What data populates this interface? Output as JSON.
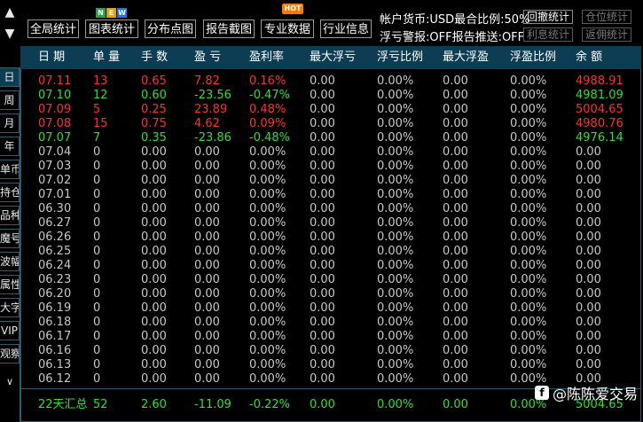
{
  "toolbar": {
    "buttons": [
      "全局统计",
      "图表统计",
      "分布点图",
      "报告截图",
      "专业数据",
      "行业信息"
    ],
    "new_badge": [
      "N",
      "E",
      "W"
    ],
    "hot_badge": "HOT"
  },
  "account": {
    "line1": "帐户货币:USD最合比例:50%",
    "line2": "浮亏警报:OFF报告推送:OFF",
    "buttons": [
      "回撤统计",
      "仓位统计",
      "利息统计",
      "返佣统计"
    ]
  },
  "scroll": {
    "up": "▲",
    "down": "▼",
    "sidebar_down": "∨"
  },
  "sidebar": {
    "items": [
      "日",
      "周",
      "月",
      "年",
      "单币",
      "持仓",
      "品种",
      "魔号",
      "波幅",
      "属性",
      "大字",
      "VIP",
      "观察"
    ],
    "active_index": 0
  },
  "table": {
    "columns": [
      "日 期",
      "单 量",
      "手 数",
      "盈 亏",
      "盈利率",
      "最大浮亏",
      "浮亏比例",
      "最大浮盈",
      "浮盈比例",
      "余 额"
    ],
    "rows": [
      {
        "date": "07.11",
        "orders": "13",
        "lots": "0.65",
        "pnl": "7.82",
        "rate": "0.16%",
        "max_float_loss": "0.00",
        "float_loss_ratio": "0.00%",
        "max_float_profit": "0.00",
        "float_profit_ratio": "0.00%",
        "balance": "4988.91",
        "tone": "red"
      },
      {
        "date": "07.10",
        "orders": "12",
        "lots": "0.60",
        "pnl": "-23.56",
        "rate": "-0.47%",
        "max_float_loss": "0.00",
        "float_loss_ratio": "0.00%",
        "max_float_profit": "0.00",
        "float_profit_ratio": "0.00%",
        "balance": "4981.09",
        "tone": "green"
      },
      {
        "date": "07.09",
        "orders": "5",
        "lots": "0.25",
        "pnl": "23.89",
        "rate": "0.48%",
        "max_float_loss": "0.00",
        "float_loss_ratio": "0.00%",
        "max_float_profit": "0.00",
        "float_profit_ratio": "0.00%",
        "balance": "5004.65",
        "tone": "red"
      },
      {
        "date": "07.08",
        "orders": "15",
        "lots": "0.75",
        "pnl": "4.62",
        "rate": "0.09%",
        "max_float_loss": "0.00",
        "float_loss_ratio": "0.00%",
        "max_float_profit": "0.00",
        "float_profit_ratio": "0.00%",
        "balance": "4980.76",
        "tone": "red"
      },
      {
        "date": "07.07",
        "orders": "7",
        "lots": "0.35",
        "pnl": "-23.86",
        "rate": "-0.48%",
        "max_float_loss": "0.00",
        "float_loss_ratio": "0.00%",
        "max_float_profit": "0.00",
        "float_profit_ratio": "0.00%",
        "balance": "4976.14",
        "tone": "green"
      },
      {
        "date": "07.04",
        "orders": "0",
        "lots": "0.00",
        "pnl": "0.00",
        "rate": "0.00%",
        "max_float_loss": "0.00",
        "float_loss_ratio": "0.00%",
        "max_float_profit": "0.00",
        "float_profit_ratio": "0.00%",
        "balance": "0.00",
        "tone": "gray"
      },
      {
        "date": "07.03",
        "orders": "0",
        "lots": "0.00",
        "pnl": "0.00",
        "rate": "0.00%",
        "max_float_loss": "0.00",
        "float_loss_ratio": "0.00%",
        "max_float_profit": "0.00",
        "float_profit_ratio": "0.00%",
        "balance": "0.00",
        "tone": "gray"
      },
      {
        "date": "07.02",
        "orders": "0",
        "lots": "0.00",
        "pnl": "0.00",
        "rate": "0.00%",
        "max_float_loss": "0.00",
        "float_loss_ratio": "0.00%",
        "max_float_profit": "0.00",
        "float_profit_ratio": "0.00%",
        "balance": "0.00",
        "tone": "gray"
      },
      {
        "date": "07.01",
        "orders": "0",
        "lots": "0.00",
        "pnl": "0.00",
        "rate": "0.00%",
        "max_float_loss": "0.00",
        "float_loss_ratio": "0.00%",
        "max_float_profit": "0.00",
        "float_profit_ratio": "0.00%",
        "balance": "0.00",
        "tone": "gray"
      },
      {
        "date": "06.30",
        "orders": "0",
        "lots": "0.00",
        "pnl": "0.00",
        "rate": "0.00%",
        "max_float_loss": "0.00",
        "float_loss_ratio": "0.00%",
        "max_float_profit": "0.00",
        "float_profit_ratio": "0.00%",
        "balance": "0.00",
        "tone": "gray"
      },
      {
        "date": "06.27",
        "orders": "0",
        "lots": "0.00",
        "pnl": "0.00",
        "rate": "0.00%",
        "max_float_loss": "0.00",
        "float_loss_ratio": "0.00%",
        "max_float_profit": "0.00",
        "float_profit_ratio": "0.00%",
        "balance": "0.00",
        "tone": "gray"
      },
      {
        "date": "06.26",
        "orders": "0",
        "lots": "0.00",
        "pnl": "0.00",
        "rate": "0.00%",
        "max_float_loss": "0.00",
        "float_loss_ratio": "0.00%",
        "max_float_profit": "0.00",
        "float_profit_ratio": "0.00%",
        "balance": "0.00",
        "tone": "gray"
      },
      {
        "date": "06.25",
        "orders": "0",
        "lots": "0.00",
        "pnl": "0.00",
        "rate": "0.00%",
        "max_float_loss": "0.00",
        "float_loss_ratio": "0.00%",
        "max_float_profit": "0.00",
        "float_profit_ratio": "0.00%",
        "balance": "0.00",
        "tone": "gray"
      },
      {
        "date": "06.24",
        "orders": "0",
        "lots": "0.00",
        "pnl": "0.00",
        "rate": "0.00%",
        "max_float_loss": "0.00",
        "float_loss_ratio": "0.00%",
        "max_float_profit": "0.00",
        "float_profit_ratio": "0.00%",
        "balance": "0.00",
        "tone": "gray"
      },
      {
        "date": "06.23",
        "orders": "0",
        "lots": "0.00",
        "pnl": "0.00",
        "rate": "0.00%",
        "max_float_loss": "0.00",
        "float_loss_ratio": "0.00%",
        "max_float_profit": "0.00",
        "float_profit_ratio": "0.00%",
        "balance": "0.00",
        "tone": "gray"
      },
      {
        "date": "06.20",
        "orders": "0",
        "lots": "0.00",
        "pnl": "0.00",
        "rate": "0.00%",
        "max_float_loss": "0.00",
        "float_loss_ratio": "0.00%",
        "max_float_profit": "0.00",
        "float_profit_ratio": "0.00%",
        "balance": "0.00",
        "tone": "gray"
      },
      {
        "date": "06.19",
        "orders": "0",
        "lots": "0.00",
        "pnl": "0.00",
        "rate": "0.00%",
        "max_float_loss": "0.00",
        "float_loss_ratio": "0.00%",
        "max_float_profit": "0.00",
        "float_profit_ratio": "0.00%",
        "balance": "0.00",
        "tone": "gray"
      },
      {
        "date": "06.18",
        "orders": "0",
        "lots": "0.00",
        "pnl": "0.00",
        "rate": "0.00%",
        "max_float_loss": "0.00",
        "float_loss_ratio": "0.00%",
        "max_float_profit": "0.00",
        "float_profit_ratio": "0.00%",
        "balance": "0.00",
        "tone": "gray"
      },
      {
        "date": "06.17",
        "orders": "0",
        "lots": "0.00",
        "pnl": "0.00",
        "rate": "0.00%",
        "max_float_loss": "0.00",
        "float_loss_ratio": "0.00%",
        "max_float_profit": "0.00",
        "float_profit_ratio": "0.00%",
        "balance": "0.00",
        "tone": "gray"
      },
      {
        "date": "06.16",
        "orders": "0",
        "lots": "0.00",
        "pnl": "0.00",
        "rate": "0.00%",
        "max_float_loss": "0.00",
        "float_loss_ratio": "0.00%",
        "max_float_profit": "0.00",
        "float_profit_ratio": "0.00%",
        "balance": "0.00",
        "tone": "gray"
      },
      {
        "date": "06.13",
        "orders": "0",
        "lots": "0.00",
        "pnl": "0.00",
        "rate": "0.00%",
        "max_float_loss": "0.00",
        "float_loss_ratio": "0.00%",
        "max_float_profit": "0.00",
        "float_profit_ratio": "0.00%",
        "balance": "0.00",
        "tone": "gray"
      },
      {
        "date": "06.12",
        "orders": "0",
        "lots": "0.00",
        "pnl": "0.00",
        "rate": "0.00%",
        "max_float_loss": "0.00",
        "float_loss_ratio": "0.00%",
        "max_float_profit": "0.00",
        "float_profit_ratio": "0.00%",
        "balance": "0.00",
        "tone": "gray"
      }
    ],
    "summary": {
      "label": "22天汇总",
      "orders": "52",
      "lots": "2.60",
      "pnl": "-11.09",
      "rate": "-0.22%",
      "max_float_loss": "0.00",
      "float_loss_ratio": "0.00%",
      "max_float_profit": "0.00",
      "float_profit_ratio": "0.00%",
      "balance": "5004.65"
    }
  },
  "watermark": {
    "text": "@陈陈爱交易",
    "icon": "f"
  },
  "colors": {
    "profit": "#ff3030",
    "loss": "#30e030",
    "header_bg": "#0c3d52",
    "border": "#2c5a70"
  }
}
